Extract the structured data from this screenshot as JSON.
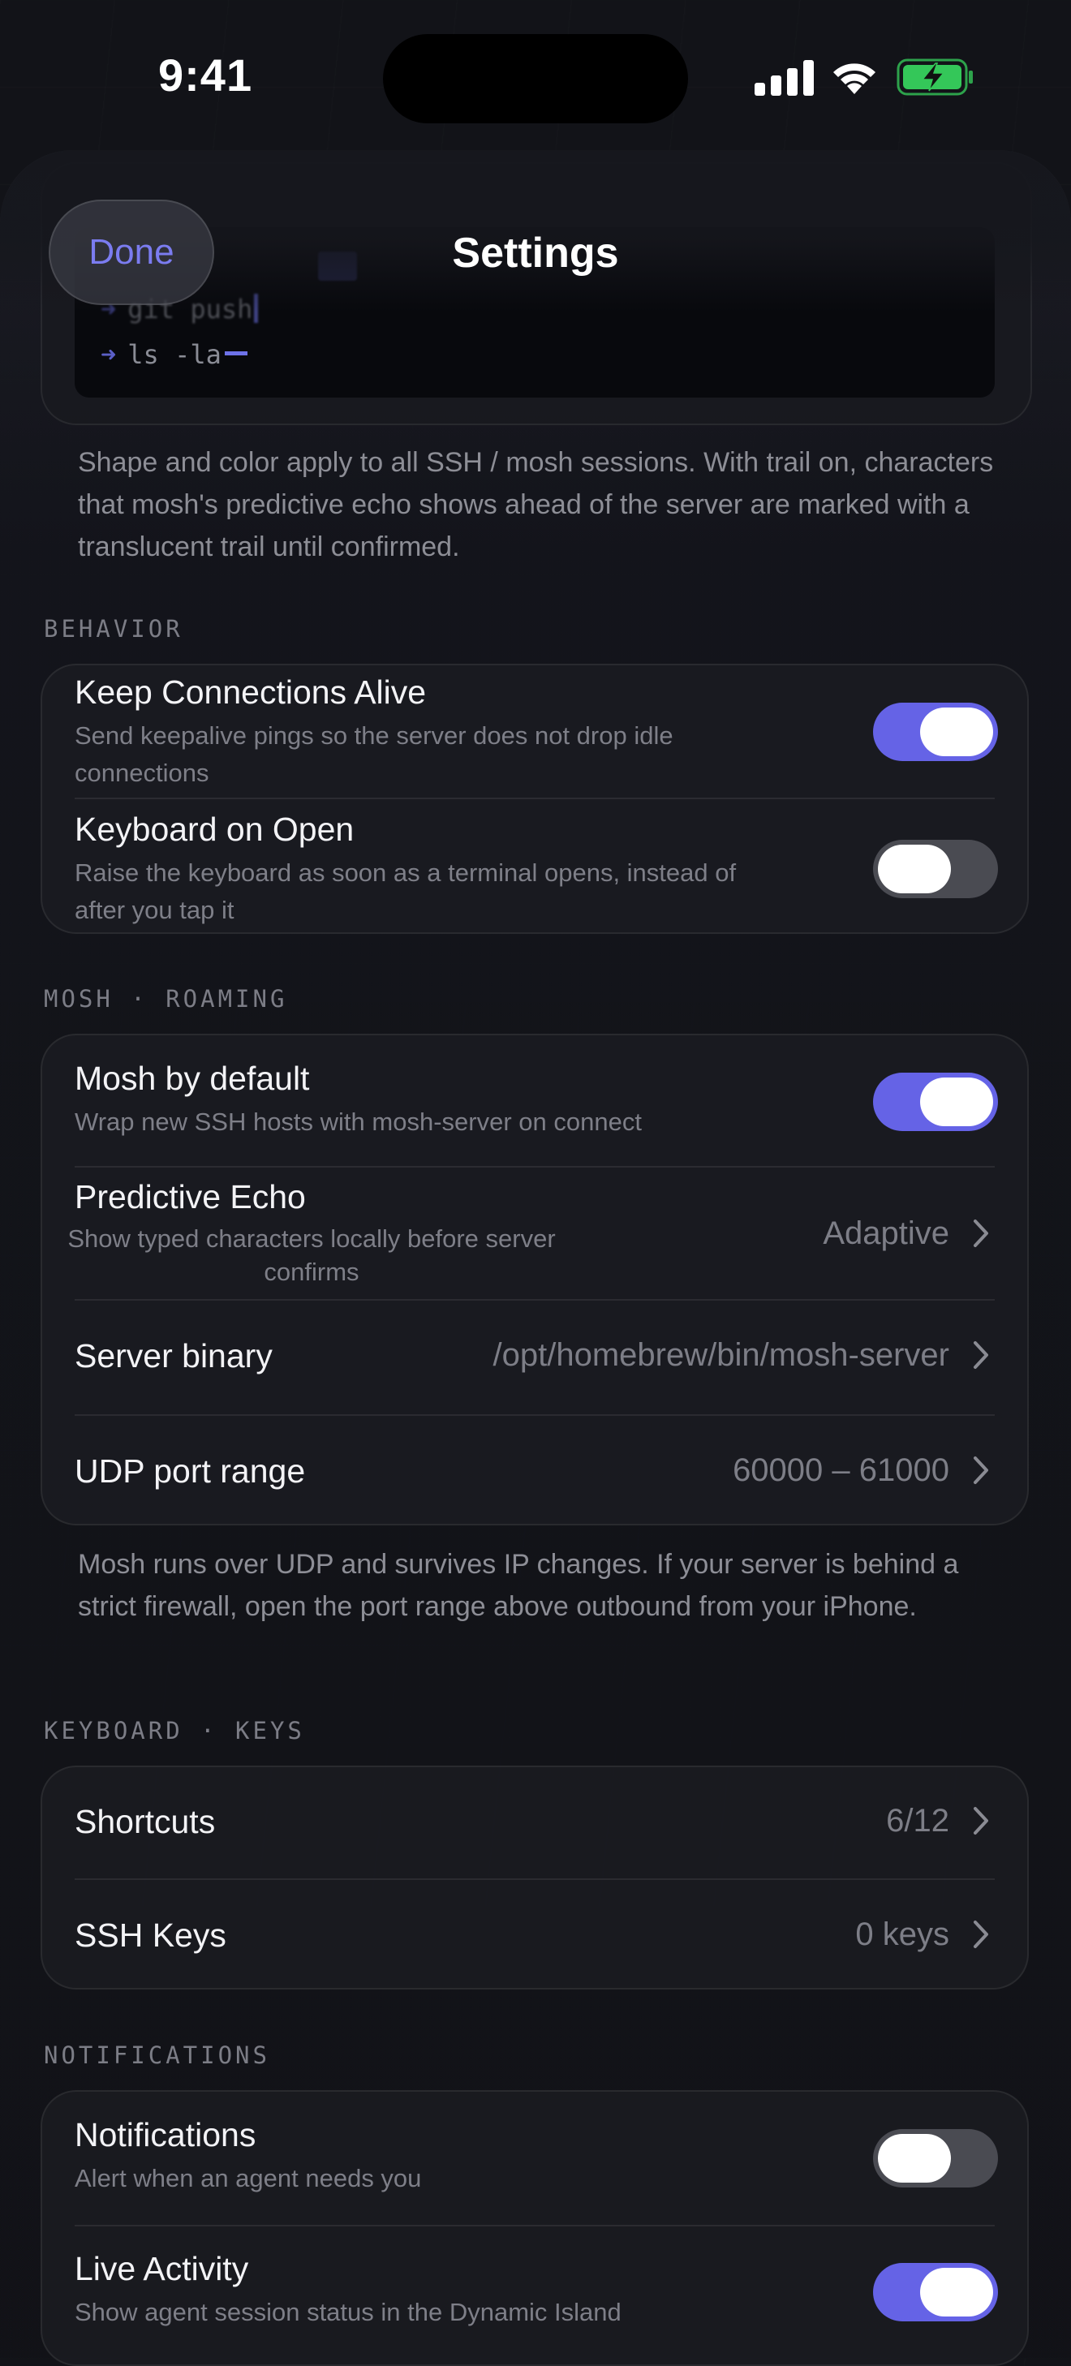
{
  "status_bar": {
    "time": "9:41",
    "icons": [
      "signal-icon",
      "wifi-icon",
      "battery-charging-icon"
    ],
    "battery_color": "#34c759"
  },
  "header": {
    "title": "Settings",
    "done_label": "Done"
  },
  "theme": {
    "accent": "#6563e6",
    "toggle_off": "#4a4b52"
  },
  "cursor_preview": {
    "lines": [
      {
        "prompt": "➜",
        "command": "git push"
      },
      {
        "prompt": "➜",
        "command": "ls -la"
      }
    ],
    "footer": "Shape and color apply to all SSH / mosh sessions. With trail on, characters that mosh's predictive echo shows ahead of the server are marked with a translucent trail until confirmed."
  },
  "behavior": {
    "header": "BEHAVIOR",
    "keep_alive": {
      "title": "Keep Connections Alive",
      "subtitle": "Send keepalive pings so the server does not drop idle connections",
      "enabled": true
    },
    "keyboard_on_open": {
      "title": "Keyboard on Open",
      "subtitle": "Raise the keyboard as soon as a terminal opens, instead of after you tap it",
      "enabled": false
    }
  },
  "mosh": {
    "header": "MOSH · ROAMING",
    "mosh_default": {
      "title": "Mosh by default",
      "subtitle": "Wrap new SSH hosts with mosh-server on connect",
      "enabled": true
    },
    "predictive_echo": {
      "title": "Predictive Echo",
      "subtitle": "Show typed characters locally before server confirms",
      "value": "Adaptive"
    },
    "server_binary": {
      "title": "Server binary",
      "value": "/opt/homebrew/bin/mosh-server"
    },
    "udp_port_range": {
      "title": "UDP port range",
      "value": "60000 – 61000"
    },
    "footer": "Mosh runs over UDP and survives IP changes. If your server is behind a strict firewall, open the port range above outbound from your iPhone."
  },
  "keyboard_keys": {
    "header": "KEYBOARD · KEYS",
    "shortcuts": {
      "title": "Shortcuts",
      "value": "6/12"
    },
    "ssh_keys": {
      "title": "SSH Keys",
      "value": "0 keys"
    }
  },
  "notifications": {
    "header": "NOTIFICATIONS",
    "notifications": {
      "title": "Notifications",
      "subtitle": "Alert when an agent needs you",
      "enabled": false
    },
    "live_activity": {
      "title": "Live Activity",
      "subtitle": "Show agent session status in the Dynamic Island",
      "enabled": true
    }
  }
}
